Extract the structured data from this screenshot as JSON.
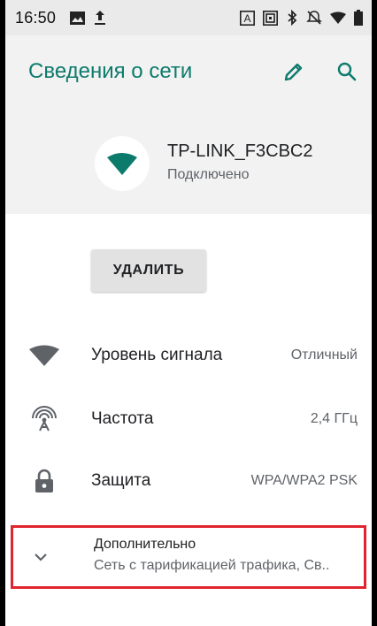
{
  "status_bar": {
    "time": "16:50",
    "left_icons": [
      "image-icon",
      "upload-icon"
    ],
    "right_icons": [
      "a-badge-icon",
      "screen-icon",
      "bluetooth-icon",
      "no-alarm-icon",
      "wifi-icon",
      "battery-icon"
    ]
  },
  "appbar": {
    "title": "Сведения о сети",
    "edit_icon": "pencil-icon",
    "search_icon": "search-icon",
    "accent_color": "#0d7b6c"
  },
  "network": {
    "name": "TP-LINK_F3CBC2",
    "status": "Подключено",
    "icon": "wifi-icon",
    "icon_color": "#0d7b6c"
  },
  "actions": {
    "delete_label": "УДАЛИТЬ"
  },
  "details": [
    {
      "icon": "wifi-signal-icon",
      "label": "Уровень сигнала",
      "value": "Отличный"
    },
    {
      "icon": "frequency-antenna-icon",
      "label": "Частота",
      "value": "2,4 ГГц"
    },
    {
      "icon": "lock-icon",
      "label": "Защита",
      "value": "WPA/WPA2 PSK"
    }
  ],
  "advanced": {
    "title": "Дополнительно",
    "subtitle": "Сеть с тарификацией трафика, Св..",
    "icon": "chevron-down-icon",
    "highlight_color": "#e0242f"
  }
}
